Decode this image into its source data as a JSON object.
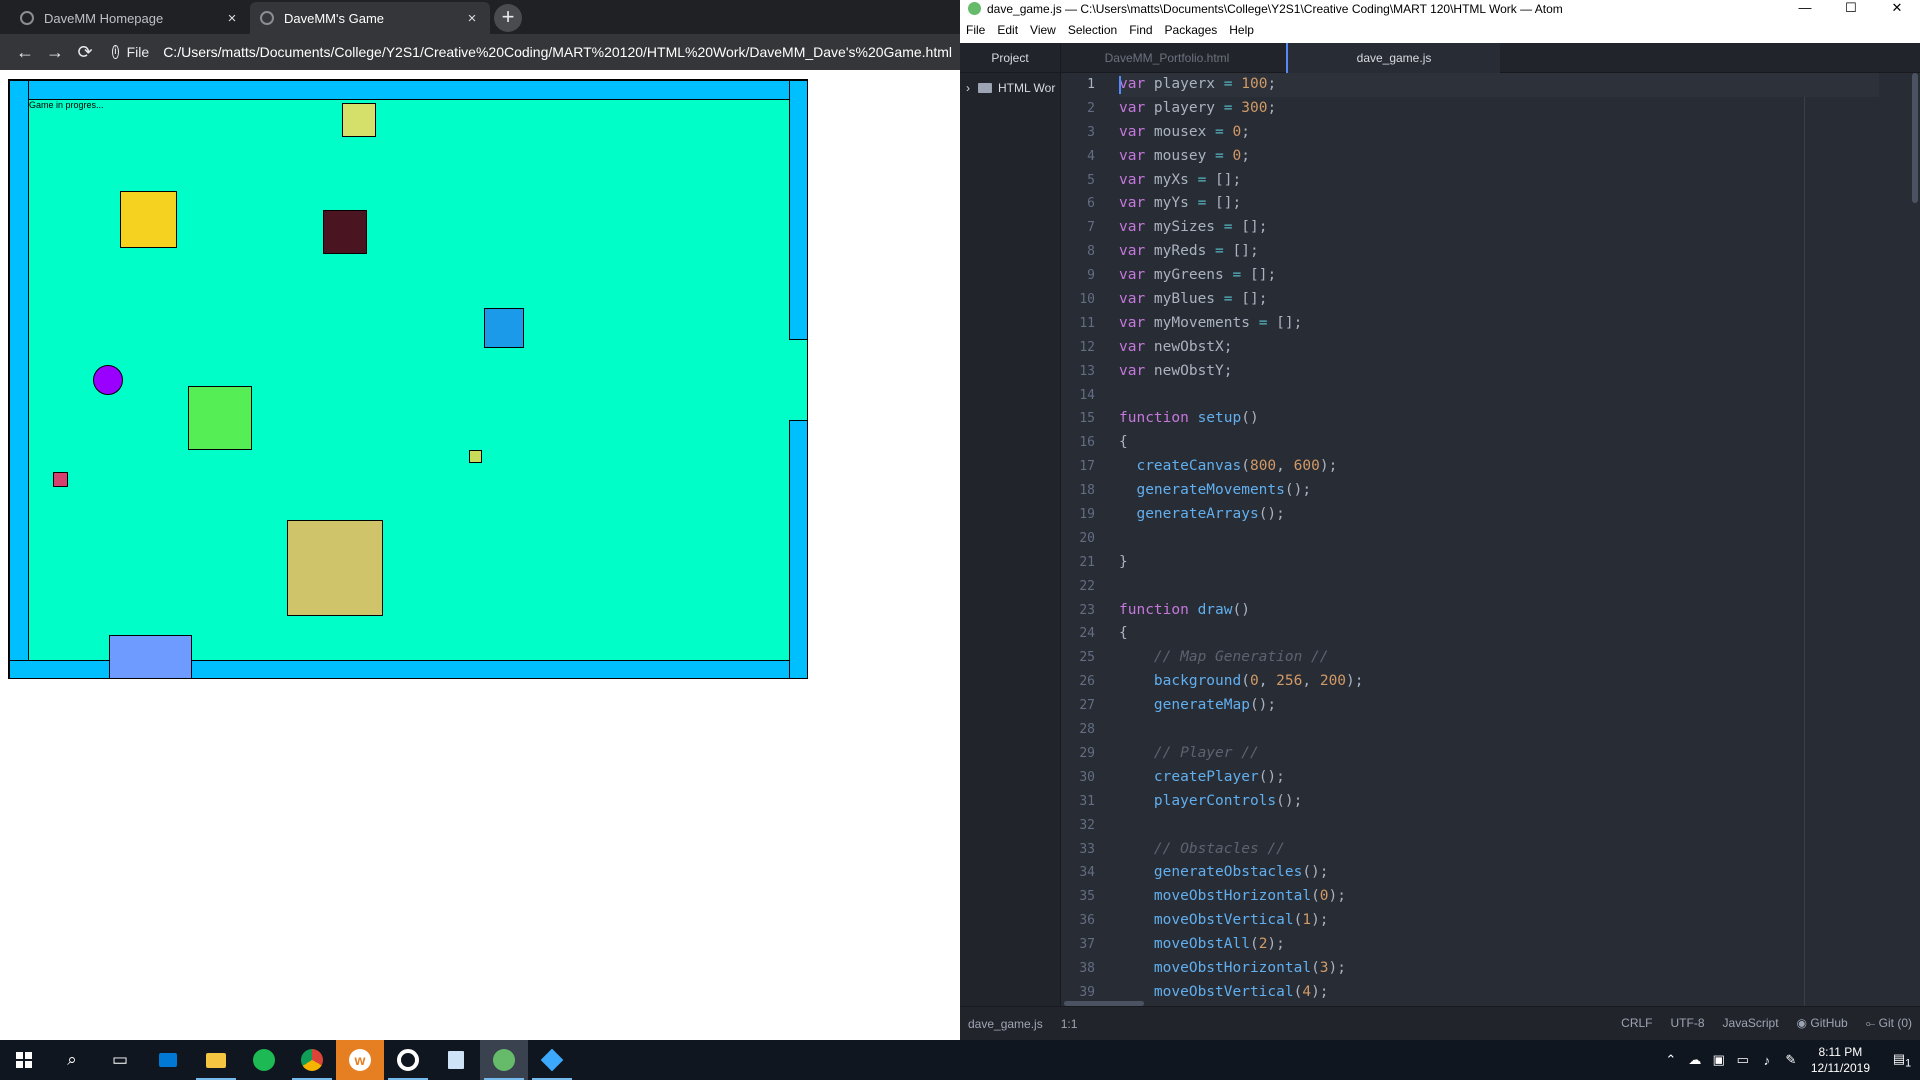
{
  "browser": {
    "tabs": [
      {
        "title": "DaveMM Homepage",
        "close": "×"
      },
      {
        "title": "DaveMM's Game",
        "close": "×"
      }
    ],
    "new_tab": "+",
    "nav": {
      "back": "←",
      "forward": "→",
      "reload": "⟳"
    },
    "info_icon": "i",
    "url_scheme": "File",
    "url": "C:/Users/matts/Documents/College/Y2S1/Creative%20Coding/MART%20120/HTML%20Work/DaveMM_Dave's%20Game.html"
  },
  "game": {
    "status_text": "Game in progres...",
    "background": "#00ffc8",
    "wall_color": "#00bfff",
    "player_color": "#9900ff",
    "obstacle_colors": [
      "#d4e06a",
      "#f5d21f",
      "#4a1520",
      "#1a9ae8",
      "#55ee55",
      "#d6406e",
      "#c8dc5a",
      "#cfc46a",
      "#6e9bff"
    ]
  },
  "atom": {
    "title": "dave_game.js — C:\\Users\\matts\\Documents\\College\\Y2S1\\Creative Coding\\MART 120\\HTML Work — Atom",
    "window_buttons": [
      "—",
      "☐",
      "✕"
    ],
    "menu": [
      "File",
      "Edit",
      "View",
      "Selection",
      "Find",
      "Packages",
      "Help"
    ],
    "tree": {
      "header": "Project",
      "item": "HTML Wor"
    },
    "tabs": [
      "DaveMM_Portfolio.html",
      "dave_game.js"
    ],
    "status": {
      "file": "dave_game.js",
      "cursor": "1:1",
      "line_ending": "CRLF",
      "encoding": "UTF-8",
      "grammar": "JavaScript",
      "github": "GitHub",
      "git": "Git (0)"
    }
  },
  "code_lines": [
    "1",
    "2",
    "3",
    "4",
    "5",
    "6",
    "7",
    "8",
    "9",
    "10",
    "11",
    "12",
    "13",
    "14",
    "15",
    "16",
    "17",
    "18",
    "19",
    "20",
    "21",
    "22",
    "23",
    "24",
    "25",
    "26",
    "27",
    "28",
    "29",
    "30",
    "31",
    "32",
    "33",
    "34",
    "35",
    "36",
    "37",
    "38",
    "39"
  ],
  "code": {
    "l1": [
      "var",
      " playerx ",
      "=",
      " ",
      "100",
      ";"
    ],
    "l2": [
      "var",
      " playery ",
      "=",
      " ",
      "300",
      ";"
    ],
    "l3": [
      "var",
      " mousex ",
      "=",
      " ",
      "0",
      ";"
    ],
    "l4": [
      "var",
      " mousey ",
      "=",
      " ",
      "0",
      ";"
    ],
    "l5": [
      "var",
      " myXs ",
      "=",
      " [];"
    ],
    "l6": [
      "var",
      " myYs ",
      "=",
      " [];"
    ],
    "l7": [
      "var",
      " mySizes ",
      "=",
      " [];"
    ],
    "l8": [
      "var",
      " myReds ",
      "=",
      " [];"
    ],
    "l9": [
      "var",
      " myGreens ",
      "=",
      " [];"
    ],
    "l10": [
      "var",
      " myBlues ",
      "=",
      " [];"
    ],
    "l11": [
      "var",
      " myMovements ",
      "=",
      " [];"
    ],
    "l12": [
      "var",
      " newObstX;"
    ],
    "l13": [
      "var",
      " newObstY;"
    ],
    "l15": [
      "function",
      " ",
      "setup",
      "()"
    ],
    "l16": "{",
    "l17": [
      "  ",
      "createCanvas",
      "(",
      "800",
      ", ",
      "600",
      ");"
    ],
    "l18": [
      "  ",
      "generateMovements",
      "();"
    ],
    "l19": [
      "  ",
      "generateArrays",
      "();"
    ],
    "l21": "}",
    "l23": [
      "function",
      " ",
      "draw",
      "()"
    ],
    "l24": "{",
    "l25": "    // Map Generation //",
    "l26": [
      "    ",
      "background",
      "(",
      "0",
      ", ",
      "256",
      ", ",
      "200",
      ");"
    ],
    "l27": [
      "    ",
      "generateMap",
      "();"
    ],
    "l29": "    // Player //",
    "l30": [
      "    ",
      "createPlayer",
      "();"
    ],
    "l31": [
      "    ",
      "playerControls",
      "();"
    ],
    "l33": "    // Obstacles //",
    "l34": [
      "    ",
      "generateObstacles",
      "();"
    ],
    "l35": [
      "    ",
      "moveObstHorizontal",
      "(",
      "0",
      ");"
    ],
    "l36": [
      "    ",
      "moveObstVertical",
      "(",
      "1",
      ");"
    ],
    "l37": [
      "    ",
      "moveObstAll",
      "(",
      "2",
      ");"
    ],
    "l38": [
      "    ",
      "moveObstHorizontal",
      "(",
      "3",
      ");"
    ],
    "l39": [
      "    ",
      "moveObstVertical",
      "(",
      "4",
      ");"
    ]
  },
  "taskbar": {
    "icons": [
      "windows-start",
      "search",
      "task-view",
      "outlook",
      "file-explorer",
      "spotify",
      "chrome",
      "app-w",
      "app-circle",
      "notepad",
      "atom",
      "app-bird"
    ],
    "clock_time": "8:11 PM",
    "clock_date": "12/11/2019",
    "notification_count": "1"
  }
}
